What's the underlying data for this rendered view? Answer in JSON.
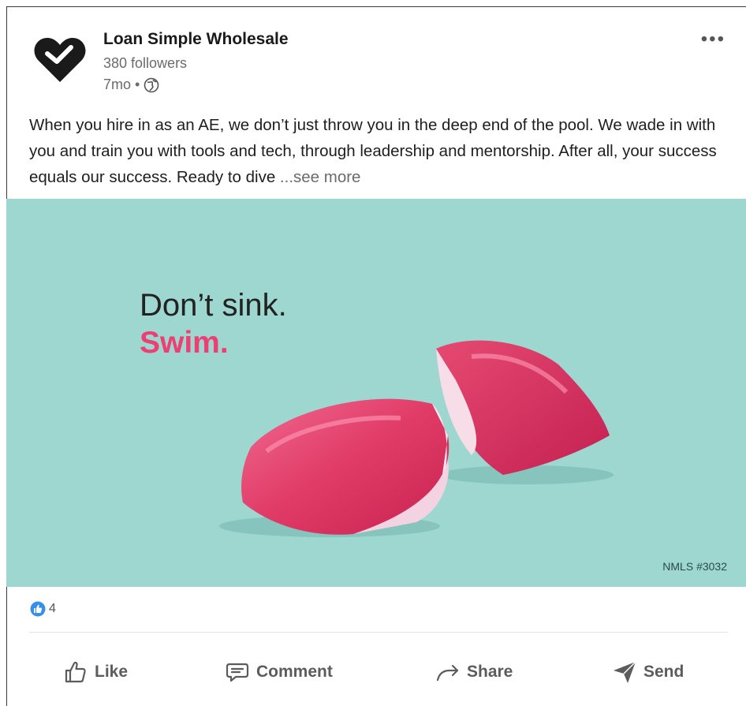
{
  "post": {
    "author": "Loan Simple Wholesale",
    "followers": "380 followers",
    "age": "7mo •",
    "text": "When you hire in as an AE, we don’t just throw you in the deep end of the pool. We wade in with you and train you with tools and tech, through leadership and mentorship. After all, your success equals our success. Ready to dive ",
    "see_more": "...see more",
    "more_menu": "•••"
  },
  "image": {
    "headline_line1": "Don’t sink.",
    "headline_line2": "Swim.",
    "nmls": "NMLS #3032",
    "background": "#9dd7d0",
    "accent": "#ee3f72"
  },
  "reactions": {
    "count": "4"
  },
  "actions": {
    "like": "Like",
    "comment": "Comment",
    "share": "Share",
    "send": "Send"
  },
  "icons": {
    "logo": "heart-check-logo",
    "visibility": "globe-icon",
    "reaction": "thumbs-up-icon",
    "like": "thumb-up-outline-icon",
    "comment": "speech-bubble-icon",
    "share": "arrow-right-icon",
    "send": "paper-plane-icon"
  }
}
